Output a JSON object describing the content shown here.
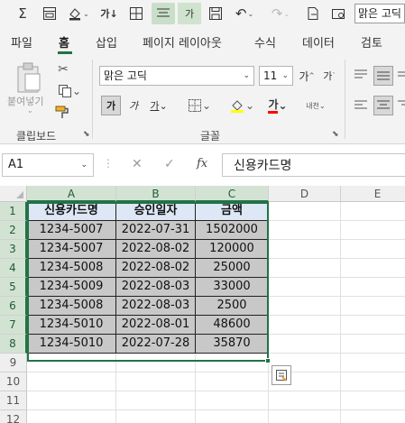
{
  "quick_access": {
    "font_name": "맑은 고딕",
    "icons": [
      "sum-icon",
      "form-icon",
      "fill-color-icon",
      "spelling-icon",
      "borders-icon",
      "align-center-icon",
      "font-size-icon",
      "save-icon",
      "undo-icon",
      "redo-icon",
      "export-icon",
      "settings-icon"
    ],
    "green_button_label": "가"
  },
  "tabs": [
    "파일",
    "홈",
    "삽입",
    "페이지 레이아웃",
    "수식",
    "데이터",
    "검토"
  ],
  "active_tab": "홈",
  "ribbon": {
    "paste_label": "붙여넣기",
    "clipboard_label": "클립보드",
    "font_group_label": "글꼴",
    "font_name": "맑은 고딕",
    "font_size": "11",
    "bold_label": "가",
    "italic_label": "가",
    "underline_label": "가",
    "font_color_label": "가",
    "grow_font_label": "가",
    "shrink_font_label": "가",
    "phonetic_label": "내천"
  },
  "formula_bar": {
    "name_box": "A1",
    "formula": "신용카드명"
  },
  "columns": [
    "A",
    "B",
    "C",
    "D",
    "E"
  ],
  "rows": [
    "1",
    "2",
    "3",
    "4",
    "5",
    "6",
    "7",
    "8",
    "9",
    "10",
    "11",
    "12"
  ],
  "table": {
    "headers": [
      "신용카드명",
      "승인일자",
      "금액"
    ],
    "rows": [
      [
        "1234-5007",
        "2022-07-31",
        "1502000"
      ],
      [
        "1234-5007",
        "2022-08-02",
        "120000"
      ],
      [
        "1234-5008",
        "2022-08-02",
        "25000"
      ],
      [
        "1234-5009",
        "2022-08-03",
        "33000"
      ],
      [
        "1234-5008",
        "2022-08-03",
        "2500"
      ],
      [
        "1234-5010",
        "2022-08-01",
        "48600"
      ],
      [
        "1234-5010",
        "2022-07-28",
        "35870"
      ]
    ]
  },
  "colors": {
    "accent": "#217346",
    "header_fill": "#dde7f5",
    "data_fill": "#c8c8c8"
  }
}
